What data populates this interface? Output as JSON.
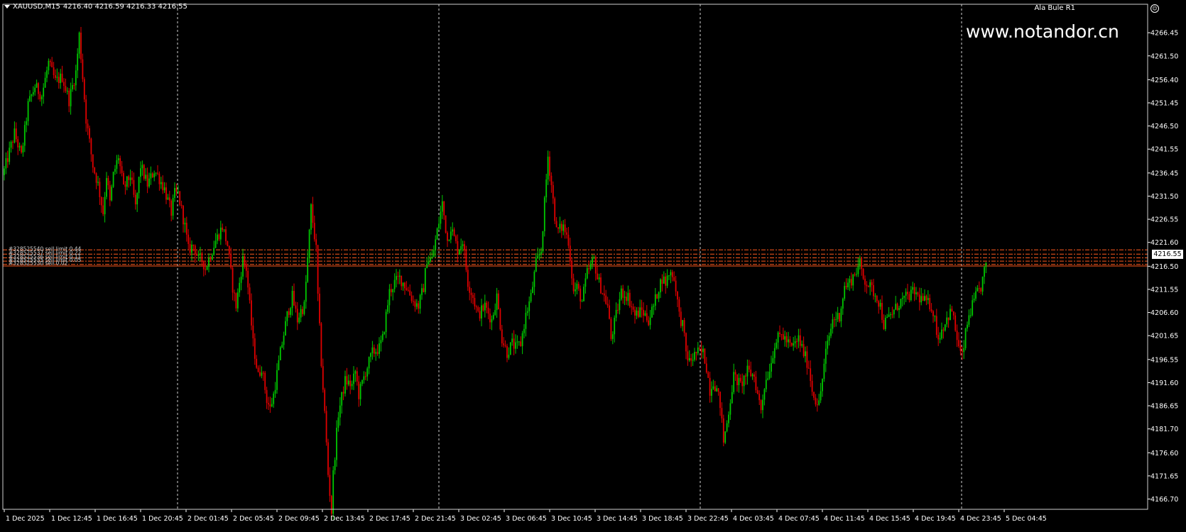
{
  "header": {
    "symbol": "XAUUSD,M15",
    "ohlc": "4216.40 4216.59 4216.33 4216.55"
  },
  "ea_label": "Ala Bule R1",
  "watermark": "www.notandor.cn",
  "current_price": "4216.55",
  "colors": {
    "background": "#000000",
    "bull": "#00c800",
    "bear": "#e00000",
    "axis": "#ffffff",
    "order_line": "#ff5a1e"
  },
  "chart_data": {
    "type": "candlestick",
    "symbol": "XAUUSD",
    "timeframe": "M15",
    "ylim": [
      4164.2,
      4268.9
    ],
    "y_ticks": [
      "4266.45",
      "4261.50",
      "4256.40",
      "4251.45",
      "4246.50",
      "4241.55",
      "4236.45",
      "4231.50",
      "4226.55",
      "4221.60",
      "4216.50",
      "4211.55",
      "4206.60",
      "4201.65",
      "4196.55",
      "4191.60",
      "4186.65",
      "4181.70",
      "4176.60",
      "4171.65",
      "4166.70"
    ],
    "x_ticks": [
      "1 Dec 2025",
      "1 Dec 12:45",
      "1 Dec 16:45",
      "1 Dec 20:45",
      "2 Dec 01:45",
      "2 Dec 05:45",
      "2 Dec 09:45",
      "2 Dec 13:45",
      "2 Dec 17:45",
      "2 Dec 21:45",
      "3 Dec 02:45",
      "3 Dec 06:45",
      "3 Dec 10:45",
      "3 Dec 14:45",
      "3 Dec 18:45",
      "3 Dec 22:45",
      "4 Dec 03:45",
      "4 Dec 07:45",
      "4 Dec 11:45",
      "4 Dec 15:45",
      "4 Dec 19:45",
      "4 Dec 23:45",
      "5 Dec 04:45"
    ],
    "day_separators": [
      "2 Dec 2025",
      "3 Dec 2025",
      "4 Dec 2025",
      "5 Dec 2025"
    ],
    "orders": [
      {
        "label": "#328525540 sell limit 0.44",
        "price": 4220.0
      },
      {
        "label": "#328525537 sell limit 0.22",
        "price": 4219.1
      },
      {
        "label": "#328525536 sell limit 0.11",
        "price": 4218.3
      },
      {
        "label": "#328525535 sell limit 0.05",
        "price": 4217.6
      },
      {
        "label": "#328525530 sell 0.02",
        "price": 4216.9
      }
    ],
    "bid_line": 4216.55,
    "path": [
      [
        0,
        4237
      ],
      [
        6,
        4245
      ],
      [
        10,
        4240
      ],
      [
        14,
        4251
      ],
      [
        18,
        4255
      ],
      [
        22,
        4253
      ],
      [
        26,
        4260
      ],
      [
        30,
        4256
      ],
      [
        34,
        4257
      ],
      [
        38,
        4252
      ],
      [
        42,
        4258
      ],
      [
        44,
        4266
      ],
      [
        48,
        4248
      ],
      [
        52,
        4238
      ],
      [
        55,
        4234
      ],
      [
        58,
        4228
      ],
      [
        60,
        4236
      ],
      [
        62,
        4230
      ],
      [
        64,
        4236
      ],
      [
        67,
        4240
      ],
      [
        70,
        4233
      ],
      [
        74,
        4236
      ],
      [
        77,
        4229
      ],
      [
        80,
        4238
      ],
      [
        84,
        4234
      ],
      [
        88,
        4237
      ],
      [
        90,
        4236
      ],
      [
        94,
        4233
      ],
      [
        98,
        4228
      ],
      [
        100,
        4232
      ],
      [
        102,
        4232
      ],
      [
        106,
        4225
      ],
      [
        108,
        4220
      ],
      [
        111,
        4221
      ],
      [
        114,
        4218
      ],
      [
        116,
        4218
      ],
      [
        118,
        4216
      ],
      [
        121,
        4219
      ],
      [
        124,
        4222
      ],
      [
        128,
        4225
      ],
      [
        131,
        4221
      ],
      [
        134,
        4212
      ],
      [
        136,
        4208
      ],
      [
        138,
        4213
      ],
      [
        140,
        4218
      ],
      [
        142,
        4216
      ],
      [
        146,
        4200
      ],
      [
        149,
        4193
      ],
      [
        151,
        4195
      ],
      [
        154,
        4188
      ],
      [
        156,
        4186
      ],
      [
        158,
        4189
      ],
      [
        162,
        4198
      ],
      [
        164,
        4202
      ],
      [
        166,
        4206
      ],
      [
        169,
        4210
      ],
      [
        172,
        4205
      ],
      [
        174,
        4207
      ],
      [
        176,
        4208
      ],
      [
        178,
        4218
      ],
      [
        180,
        4229
      ],
      [
        183,
        4220
      ],
      [
        184,
        4210
      ],
      [
        186,
        4196
      ],
      [
        188,
        4185
      ],
      [
        190,
        4172
      ],
      [
        192,
        4164
      ],
      [
        193,
        4172
      ],
      [
        196,
        4185
      ],
      [
        200,
        4192
      ],
      [
        204,
        4191
      ],
      [
        206,
        4194
      ],
      [
        208,
        4189
      ],
      [
        212,
        4194
      ],
      [
        216,
        4198
      ],
      [
        220,
        4199
      ],
      [
        222,
        4201
      ],
      [
        226,
        4211
      ],
      [
        229,
        4213
      ],
      [
        232,
        4214
      ],
      [
        236,
        4212
      ],
      [
        240,
        4209
      ],
      [
        243,
        4208
      ],
      [
        246,
        4212
      ],
      [
        248,
        4218
      ],
      [
        251,
        4218
      ],
      [
        253,
        4222
      ],
      [
        255,
        4226
      ],
      [
        257,
        4230
      ],
      [
        260,
        4222
      ],
      [
        262,
        4225
      ],
      [
        266,
        4220
      ],
      [
        269,
        4222
      ],
      [
        272,
        4213
      ],
      [
        275,
        4210
      ],
      [
        278,
        4206
      ],
      [
        282,
        4208
      ],
      [
        286,
        4205
      ],
      [
        289,
        4210
      ],
      [
        292,
        4201
      ],
      [
        295,
        4198
      ],
      [
        298,
        4200
      ],
      [
        300,
        4199
      ],
      [
        303,
        4200
      ],
      [
        306,
        4206
      ],
      [
        309,
        4210
      ],
      [
        312,
        4217
      ],
      [
        315,
        4220
      ],
      [
        319,
        4240
      ],
      [
        321,
        4234
      ],
      [
        324,
        4224
      ],
      [
        328,
        4225
      ],
      [
        331,
        4222
      ],
      [
        334,
        4211
      ],
      [
        336,
        4212
      ],
      [
        339,
        4209
      ],
      [
        342,
        4215
      ],
      [
        346,
        4218
      ],
      [
        348,
        4214
      ],
      [
        351,
        4211
      ],
      [
        354,
        4208
      ],
      [
        356,
        4201
      ],
      [
        359,
        4206
      ],
      [
        362,
        4211
      ],
      [
        366,
        4210
      ],
      [
        370,
        4206
      ],
      [
        374,
        4207
      ],
      [
        378,
        4205
      ],
      [
        381,
        4208
      ],
      [
        384,
        4212
      ],
      [
        386,
        4214
      ],
      [
        388,
        4213
      ],
      [
        390,
        4215
      ],
      [
        392,
        4215
      ],
      [
        394,
        4212
      ],
      [
        396,
        4206
      ],
      [
        398,
        4204
      ],
      [
        400,
        4198
      ],
      [
        402,
        4196
      ],
      [
        406,
        4198
      ],
      [
        410,
        4198
      ],
      [
        412,
        4195
      ],
      [
        414,
        4190
      ],
      [
        416,
        4192
      ],
      [
        418,
        4190
      ],
      [
        420,
        4187
      ],
      [
        422,
        4179
      ],
      [
        424,
        4183
      ],
      [
        426,
        4188
      ],
      [
        428,
        4193
      ],
      [
        432,
        4191
      ],
      [
        436,
        4194
      ],
      [
        440,
        4193
      ],
      [
        442,
        4189
      ],
      [
        444,
        4186
      ],
      [
        446,
        4191
      ],
      [
        450,
        4196
      ],
      [
        452,
        4200
      ],
      [
        456,
        4202
      ],
      [
        460,
        4200
      ],
      [
        462,
        4199
      ],
      [
        466,
        4201
      ],
      [
        468,
        4199
      ],
      [
        472,
        4195
      ],
      [
        474,
        4190
      ],
      [
        476,
        4188
      ],
      [
        478,
        4187
      ],
      [
        482,
        4198
      ],
      [
        486,
        4205
      ],
      [
        490,
        4206
      ],
      [
        493,
        4212
      ],
      [
        496,
        4213
      ],
      [
        499,
        4215
      ],
      [
        502,
        4217
      ],
      [
        504,
        4214
      ],
      [
        508,
        4212
      ],
      [
        512,
        4210
      ],
      [
        514,
        4208
      ],
      [
        516,
        4204
      ],
      [
        518,
        4205
      ],
      [
        522,
        4207
      ],
      [
        526,
        4209
      ],
      [
        530,
        4210
      ],
      [
        534,
        4211
      ],
      [
        536,
        4210
      ],
      [
        540,
        4209
      ],
      [
        544,
        4208
      ],
      [
        546,
        4205
      ],
      [
        548,
        4201
      ],
      [
        550,
        4203
      ],
      [
        554,
        4206
      ],
      [
        556,
        4207
      ],
      [
        558,
        4203
      ],
      [
        560,
        4199
      ],
      [
        562,
        4197
      ],
      [
        564,
        4202
      ],
      [
        566,
        4206
      ],
      [
        568,
        4208
      ],
      [
        570,
        4210
      ],
      [
        573,
        4212
      ],
      [
        576,
        4217
      ]
    ]
  }
}
